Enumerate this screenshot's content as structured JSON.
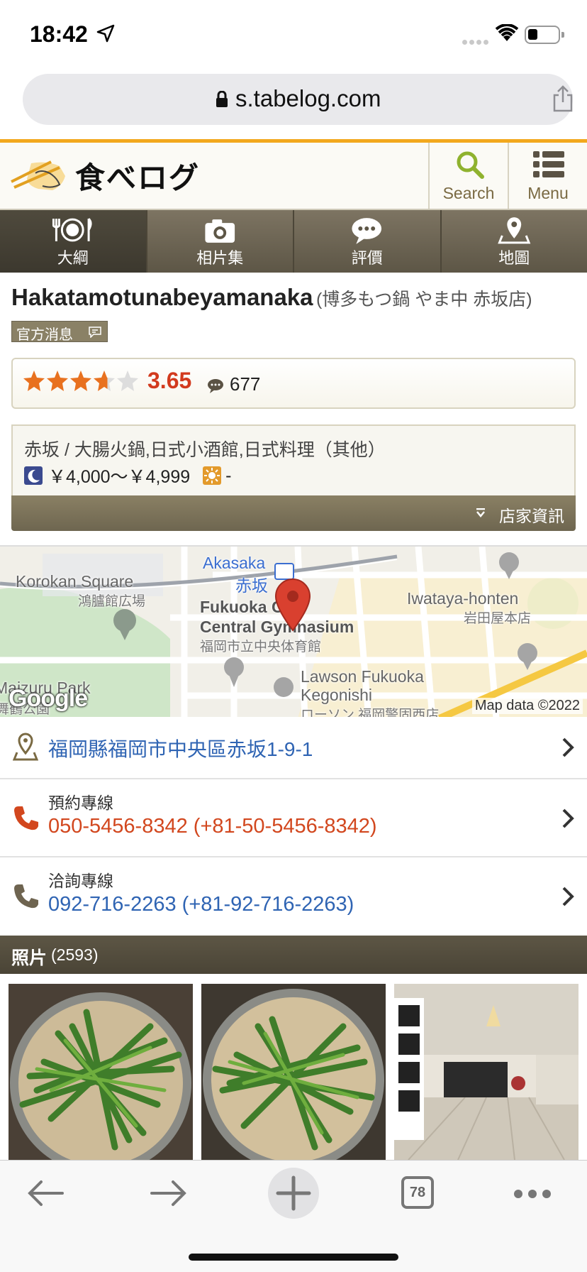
{
  "status_bar": {
    "time": "18:42"
  },
  "browser": {
    "url": "s.tabelog.com",
    "tab_count": "78"
  },
  "site": {
    "logo_text": "食べログ",
    "search_label": "Search",
    "menu_label": "Menu"
  },
  "nav_tabs": [
    {
      "label": "大綱",
      "active": true
    },
    {
      "label": "相片集"
    },
    {
      "label": "評價"
    },
    {
      "label": "地圖"
    }
  ],
  "restaurant": {
    "name": "Hakatamotunabeyamanaka",
    "name_ja": "(博多もつ鍋 やま中 赤坂店)",
    "official_badge": "官方消息",
    "rating": "3.65",
    "rating_value": 3.65,
    "review_count": "677",
    "genre": "赤坂 / 大腸火鍋,日式小酒館,日式料理（其他）",
    "dinner_budget": "￥4,000～￥4,999",
    "lunch_budget": "-",
    "info_toggle": "店家資訊"
  },
  "map": {
    "labels": {
      "akasaka": "Akasaka",
      "akasaka_ja": "赤坂",
      "korokan_en": "Korokan Square",
      "korokan_ja": "鴻臚館広場",
      "gym_en_1": "Fukuoka City",
      "gym_en_2": "Central Gymnasium",
      "gym_ja": "福岡市立中央体育館",
      "iwataya_en": "Iwataya-honten",
      "iwataya_ja": "岩田屋本店",
      "lawson_en_1": "Lawson Fukuoka",
      "lawson_en_2": "Kegonishi",
      "lawson_ja": "ローソン 福岡警固西店",
      "park_en": "Maizuru Park",
      "park_ja": "舞鶴公園"
    },
    "google": "Google",
    "attribution": "Map data ©2022"
  },
  "details": {
    "address": "福岡縣福岡市中央區赤坂1-9-1",
    "reservation_label": "預約專線",
    "reservation_number": "050-5456-8342 (+81-50-5456-8342)",
    "inquiry_label": "洽詢專線",
    "inquiry_number": "092-716-2263 (+81-92-716-2263)"
  },
  "photos": {
    "title": "照片",
    "count": "(2593)"
  },
  "colors": {
    "accent": "#f2a81d",
    "nav_bg": "#6e6553",
    "score_red": "#d23a1e",
    "link_blue": "#2f64b3",
    "phone_red": "#d2471e"
  }
}
